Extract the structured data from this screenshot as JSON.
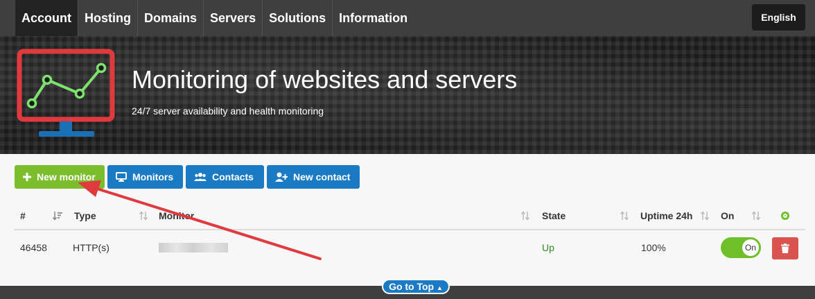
{
  "nav": {
    "items": [
      {
        "label": "Account",
        "active": true
      },
      {
        "label": "Hosting"
      },
      {
        "label": "Domains"
      },
      {
        "label": "Servers"
      },
      {
        "label": "Solutions"
      },
      {
        "label": "Information"
      }
    ],
    "language": "English"
  },
  "hero": {
    "title": "Monitoring of websites and servers",
    "subtitle": "24/7 server availability and health monitoring"
  },
  "actions": {
    "new_monitor": "New monitor",
    "monitors": "Monitors",
    "contacts": "Contacts",
    "new_contact": "New contact"
  },
  "table": {
    "headers": {
      "num": "#",
      "type": "Type",
      "monitor": "Monitor",
      "state": "State",
      "uptime": "Uptime 24h",
      "on": "On"
    },
    "rows": [
      {
        "num": "46458",
        "type": "HTTP(s)",
        "state": "Up",
        "uptime": "100%",
        "toggle": "On"
      }
    ]
  },
  "footer": {
    "goto_top": "Go to Top"
  },
  "colors": {
    "accent_green": "#7bbd2c",
    "accent_blue": "#1a7bc4",
    "danger": "#d9534f",
    "nav_bg": "#3f3f3f",
    "annotation": "#e0393e"
  }
}
